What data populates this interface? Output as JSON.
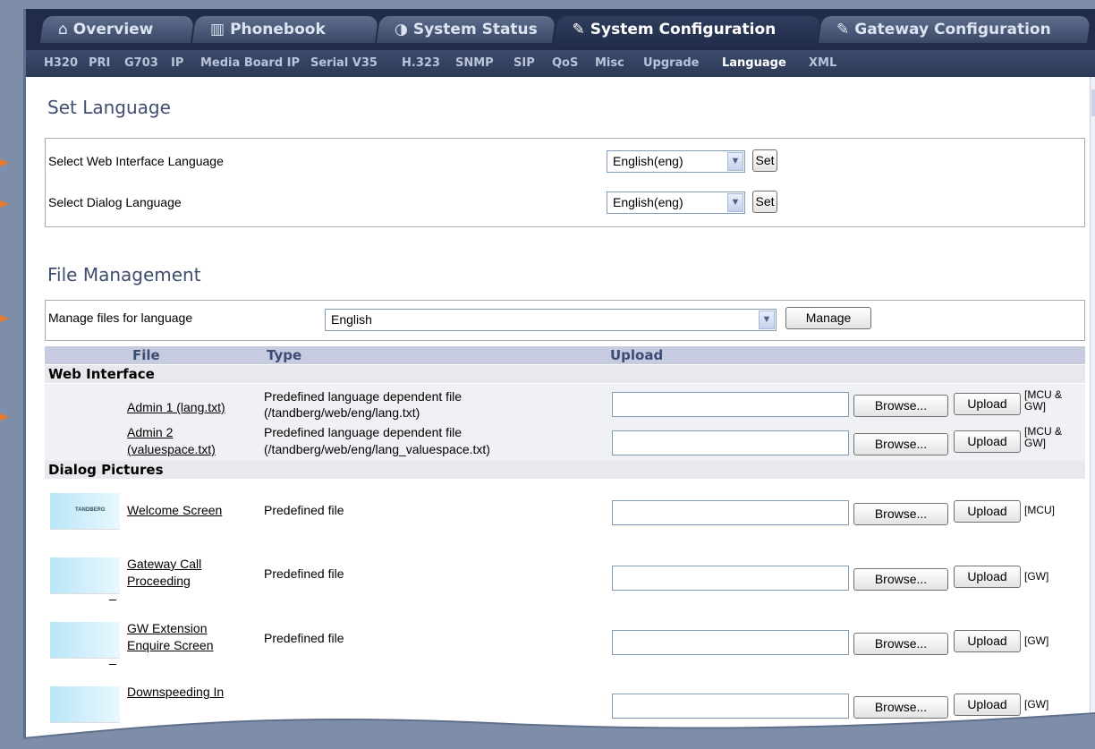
{
  "tabs": [
    {
      "icon": "⌂",
      "label": "Overview"
    },
    {
      "icon": "▥",
      "label": "Phonebook"
    },
    {
      "icon": "◑",
      "label": "System Status"
    },
    {
      "icon": "✎",
      "label": "System Configuration"
    },
    {
      "icon": "✎",
      "label": "Gateway Configuration"
    }
  ],
  "subnav": [
    "H320",
    "PRI",
    "G703",
    "IP",
    "Media Board IP",
    "Serial V35",
    "H.323",
    "SNMP",
    "SIP",
    "QoS",
    "Misc",
    "Upgrade",
    "Language",
    "XML"
  ],
  "set_language": {
    "title": "Set Language",
    "rows": [
      {
        "label": "Select Web Interface Language",
        "value": "English(eng)",
        "button": "Set"
      },
      {
        "label": "Select Dialog Language",
        "value": "English(eng)",
        "button": "Set"
      }
    ]
  },
  "file_management": {
    "title": "File Management",
    "manage_label": "Manage files for language",
    "manage_value": "English",
    "manage_button": "Manage"
  },
  "table": {
    "headers": {
      "file": "File",
      "type": "Type",
      "upload": "Upload"
    },
    "groups": {
      "web": "Web Interface",
      "dialog": "Dialog Pictures"
    },
    "browse": "Browse...",
    "upload": "Upload",
    "rows": [
      {
        "file": "Admin 1 (lang.txt)",
        "type1": "Predefined language dependent file",
        "type2": "(/tandberg/web/eng/lang.txt)",
        "note": "[MCU & GW]"
      },
      {
        "file1": "Admin 2",
        "file2": "(valuespace.txt)",
        "type1": "Predefined language dependent file",
        "type2": "(/tandberg/web/eng/lang_valuespace.txt)",
        "note": "[MCU & GW]"
      },
      {
        "file": "Welcome Screen",
        "type": "Predefined file",
        "note": "[MCU]",
        "thumb": "TANDBERG"
      },
      {
        "file1": "Gateway Call",
        "file2": "Proceeding",
        "type": "Predefined file",
        "note": "[GW]"
      },
      {
        "file1": "GW Extension",
        "file2": "Enquire Screen",
        "type": "Predefined file",
        "note": "[GW]"
      },
      {
        "file1": "Downspeeding In",
        "note": "[GW]"
      }
    ]
  }
}
